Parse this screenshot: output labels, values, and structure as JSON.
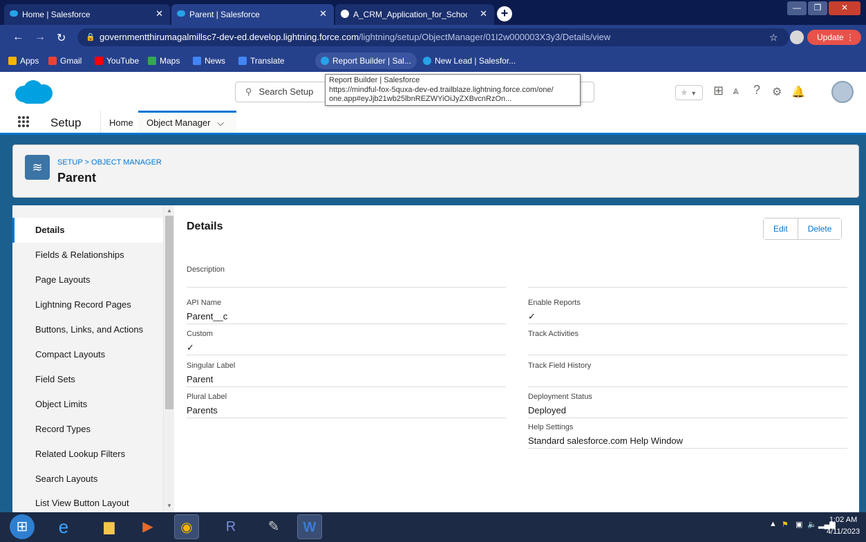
{
  "browser": {
    "tabs": [
      {
        "label": "Home | Salesforce",
        "active": false
      },
      {
        "label": "Parent | Salesforce",
        "active": true
      },
      {
        "label": "A_CRM_Application_for_Schools",
        "active": false
      }
    ],
    "new_tab": "+",
    "url_host": "governmentthirumagalmillsc7-dev-ed.develop.lightning.force.com",
    "url_path": "/lightning/setup/ObjectManager/01I2w000003X3y3/Details/view",
    "update_label": "Update",
    "bookmarks": [
      "Apps",
      "Gmail",
      "YouTube",
      "Maps",
      "News",
      "Translate",
      "Report Builder | Sal...",
      "New Lead | Salesfor..."
    ],
    "tooltip": {
      "line1": "Report Builder | Salesforce",
      "line2": "https://mindful-fox-5quxa-dev-ed.trailblaze.lightning.force.com/one/",
      "line3": "one.app#eyJjb21wb25lbnREZWYiOiJyZXBvcnRzOn..."
    }
  },
  "sf": {
    "search_placeholder": "Search Setup",
    "app_name": "Setup",
    "nav": {
      "home": "Home",
      "object_manager": "Object Manager"
    },
    "breadcrumb": "SETUP > OBJECT MANAGER",
    "object_title": "Parent",
    "sidebar": [
      "Details",
      "Fields & Relationships",
      "Page Layouts",
      "Lightning Record Pages",
      "Buttons, Links, and Actions",
      "Compact Layouts",
      "Field Sets",
      "Object Limits",
      "Record Types",
      "Related Lookup Filters",
      "Search Layouts",
      "List View Button Layout"
    ],
    "details": {
      "title": "Details",
      "edit": "Edit",
      "delete": "Delete",
      "description_label": "Description",
      "api_name_label": "API Name",
      "api_name_value": "Parent__c",
      "custom_label": "Custom",
      "custom_value": "✓",
      "singular_label": "Singular Label",
      "singular_value": "Parent",
      "plural_label": "Plural Label",
      "plural_value": "Parents",
      "enable_reports_label": "Enable Reports",
      "enable_reports_value": "✓",
      "track_activities_label": "Track Activities",
      "track_history_label": "Track Field History",
      "deployment_label": "Deployment Status",
      "deployment_value": "Deployed",
      "help_label": "Help Settings",
      "help_value": "Standard salesforce.com Help Window"
    }
  },
  "taskbar": {
    "time": "1:02 AM",
    "date": "4/11/2023"
  }
}
